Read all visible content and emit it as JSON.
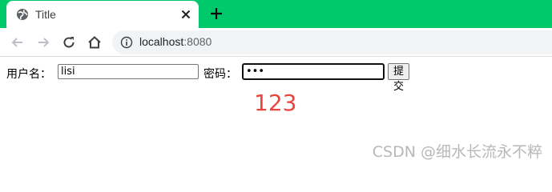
{
  "browser": {
    "tab": {
      "title": "Title"
    },
    "address": {
      "host": "localhost",
      "port": ":8080"
    },
    "colors": {
      "tabstrip": "#00c96b"
    }
  },
  "page": {
    "form": {
      "username_label": "用户名：",
      "username_value": "lisi",
      "password_label": "密码：",
      "password_value": "•••",
      "submit_label": "提交"
    },
    "result_text": "123",
    "result_color": "#e8463f"
  },
  "watermark": "CSDN @细水长流永不粹"
}
